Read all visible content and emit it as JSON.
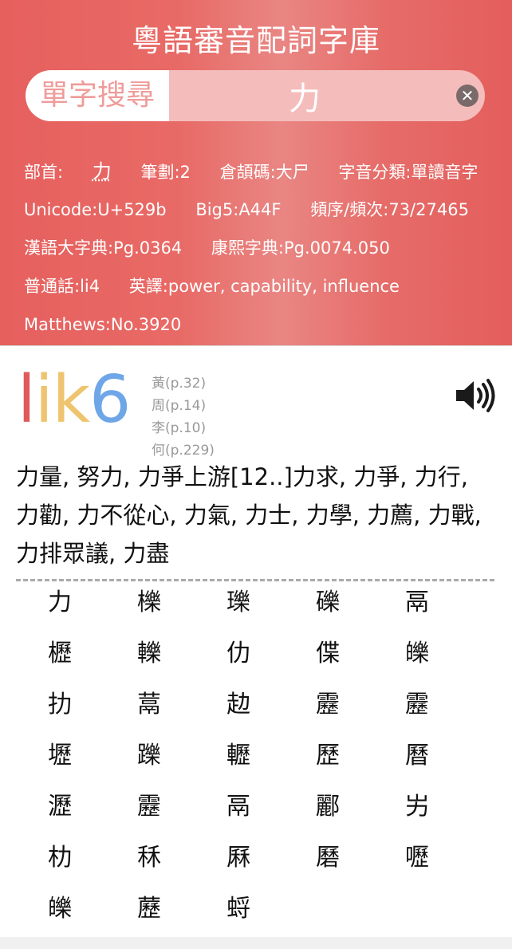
{
  "header": {
    "title": "粵語審音配詞字庫",
    "search_mode_label": "單字搜尋",
    "search_value": "力",
    "clear_icon": "close-circle-icon"
  },
  "info": {
    "radical_label": "部首:",
    "radical_glyph": "力",
    "strokes": "筆劃:2",
    "cangjie": "倉頡碼:大尸",
    "classification": "字音分類:單讀音字",
    "unicode": "Unicode:U+529b",
    "big5": "Big5:A44F",
    "frequency": "頻序/頻次:73/27465",
    "hanyu_da_zidian": "漢語大字典:Pg.0364",
    "kangxi": "康熙字典:Pg.0074.050",
    "putonghua": "普通話:li4",
    "english": "英譯:power, capability, influence",
    "matthews": "Matthews:No.3920"
  },
  "pronunciation": {
    "jyutping_initial": "l",
    "jyutping_final": "ik",
    "jyutping_tone": "6",
    "references": [
      "黃(p.32)",
      "周(p.14)",
      "李(p.10)",
      "何(p.229)"
    ],
    "speaker_icon": "speaker-volume-icon"
  },
  "words": "力量, 努力, 力爭上游[12..]力求, 力爭, 力行, 力勸, 力不從心, 力氣, 力士, 力學, 力薦, 力戰, 力排眾議, 力盡",
  "homophones": [
    "力",
    "櫟",
    "瓅",
    "礫",
    "鬲",
    "櫪",
    "轢",
    "仂",
    "偞",
    "皪",
    "扐",
    "蒚",
    "赲",
    "靂",
    "靂",
    "壢",
    "躒",
    "轣",
    "歷",
    "曆",
    "瀝",
    "靂",
    "鬲",
    "酈",
    "屴",
    "朸",
    "秝",
    "厤",
    "磿",
    "嚦",
    "皪",
    "藶",
    "蛶"
  ],
  "colors": {
    "header_bg": "#e6605e",
    "jyutping_initial": "#e15a5a",
    "jyutping_final": "#eec46e",
    "jyutping_tone": "#6ea6e8"
  }
}
